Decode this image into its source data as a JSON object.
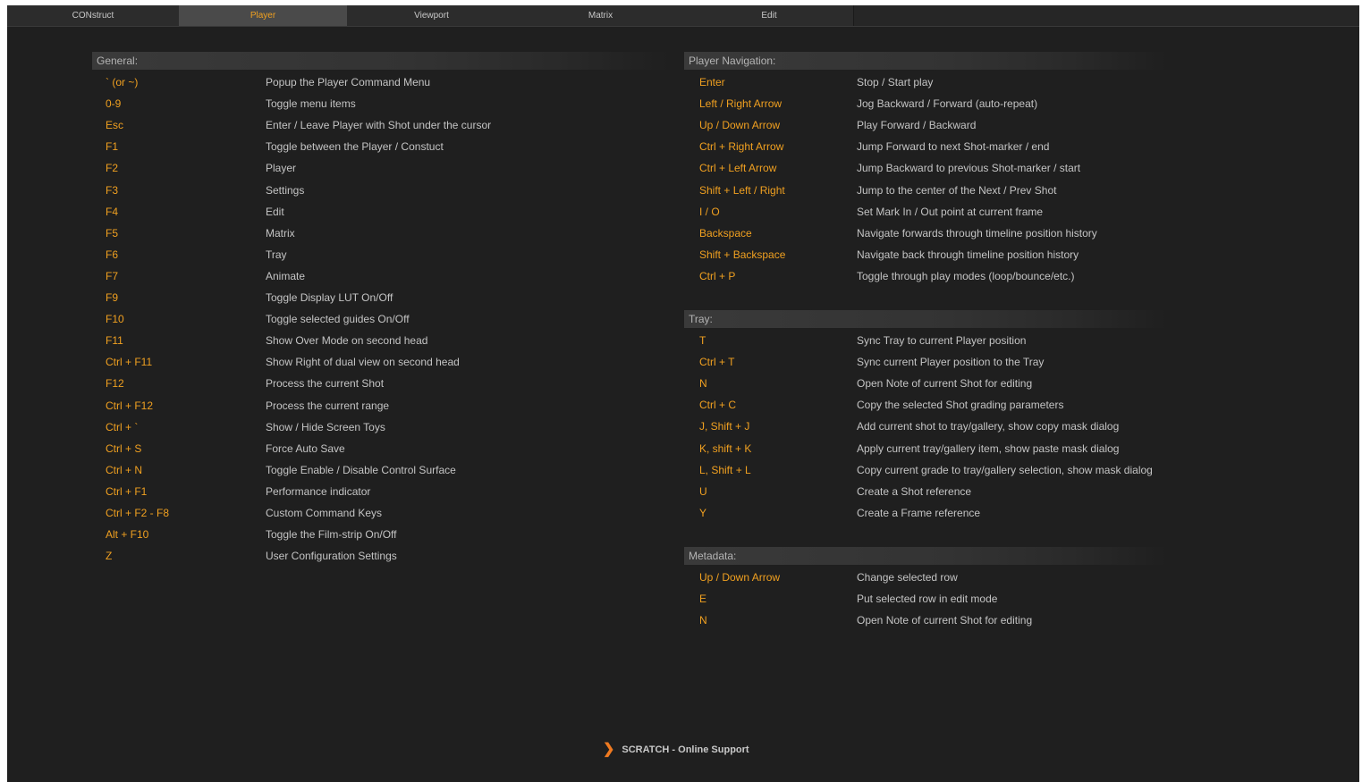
{
  "tabs": [
    {
      "label": "CONstruct",
      "active": false
    },
    {
      "label": "Player",
      "active": true
    },
    {
      "label": "Viewport",
      "active": false
    },
    {
      "label": "Matrix",
      "active": false
    },
    {
      "label": "Edit",
      "active": false
    }
  ],
  "sections": {
    "general": {
      "title": "General:",
      "rows": [
        {
          "key": "` (or ~)",
          "desc": "Popup the Player Command Menu"
        },
        {
          "key": "0-9",
          "desc": "Toggle menu items"
        },
        {
          "key": "Esc",
          "desc": "Enter / Leave Player with Shot under the cursor"
        },
        {
          "key": "F1",
          "desc": "Toggle between the Player / Constuct"
        },
        {
          "key": "F2",
          "desc": "Player"
        },
        {
          "key": "F3",
          "desc": "Settings"
        },
        {
          "key": "F4",
          "desc": "Edit"
        },
        {
          "key": "F5",
          "desc": "Matrix"
        },
        {
          "key": "F6",
          "desc": "Tray"
        },
        {
          "key": "F7",
          "desc": "Animate"
        },
        {
          "key": "F9",
          "desc": "Toggle Display LUT On/Off"
        },
        {
          "key": "F10",
          "desc": "Toggle selected guides On/Off"
        },
        {
          "key": "F11",
          "desc": "Show Over Mode on second head"
        },
        {
          "key": "Ctrl + F11",
          "desc": "Show Right of dual view on second head"
        },
        {
          "key": "F12",
          "desc": "Process the current Shot"
        },
        {
          "key": "Ctrl + F12",
          "desc": "Process the current range"
        },
        {
          "key": "Ctrl + `",
          "desc": "Show / Hide Screen Toys"
        },
        {
          "key": "Ctrl + S",
          "desc": "Force Auto Save"
        },
        {
          "key": "Ctrl + N",
          "desc": "Toggle Enable / Disable Control Surface"
        },
        {
          "key": "Ctrl + F1",
          "desc": "Performance indicator"
        },
        {
          "key": "Ctrl + F2 - F8",
          "desc": "Custom Command Keys"
        },
        {
          "key": "Alt + F10",
          "desc": "Toggle the Film-strip On/Off"
        },
        {
          "key": "Z",
          "desc": "User Configuration Settings"
        }
      ]
    },
    "player_navigation": {
      "title": "Player Navigation:",
      "rows": [
        {
          "key": "Enter",
          "desc": "Stop / Start play"
        },
        {
          "key": "Left / Right Arrow",
          "desc": "Jog Backward / Forward (auto-repeat)"
        },
        {
          "key": "Up / Down Arrow",
          "desc": "Play Forward / Backward"
        },
        {
          "key": "Ctrl + Right Arrow",
          "desc": "Jump Forward to next Shot-marker / end"
        },
        {
          "key": "Ctrl + Left Arrow",
          "desc": "Jump Backward to previous Shot-marker / start"
        },
        {
          "key": "Shift + Left / Right",
          "desc": "Jump to the center of the Next / Prev Shot"
        },
        {
          "key": "I / O",
          "desc": "Set Mark In / Out point at current frame"
        },
        {
          "key": "Backspace",
          "desc": "Navigate forwards through timeline position history"
        },
        {
          "key": "Shift + Backspace",
          "desc": "Navigate back through timeline position history"
        },
        {
          "key": "Ctrl + P",
          "desc": "Toggle through play modes (loop/bounce/etc.)"
        }
      ]
    },
    "tray": {
      "title": "Tray:",
      "rows": [
        {
          "key": "T",
          "desc": "Sync Tray to current Player position"
        },
        {
          "key": "Ctrl + T",
          "desc": "Sync current Player position to the Tray"
        },
        {
          "key": "N",
          "desc": "Open Note of current Shot for editing"
        },
        {
          "key": "Ctrl + C",
          "desc": "Copy the selected Shot grading parameters"
        },
        {
          "key": "J, Shift + J",
          "desc": "Add current shot to tray/gallery, show copy mask dialog"
        },
        {
          "key": "K, shift + K",
          "desc": "Apply current tray/gallery item, show paste mask dialog"
        },
        {
          "key": "L, Shift + L",
          "desc": "Copy current grade to tray/gallery selection, show mask dialog"
        },
        {
          "key": "U",
          "desc": "Create a Shot reference"
        },
        {
          "key": "Y",
          "desc": "Create a Frame reference"
        }
      ]
    },
    "metadata": {
      "title": "Metadata:",
      "rows": [
        {
          "key": "Up / Down Arrow",
          "desc": "Change selected row"
        },
        {
          "key": "E",
          "desc": "Put selected row in edit mode"
        },
        {
          "key": "N",
          "desc": "Open Note of current Shot for editing"
        }
      ]
    }
  },
  "footer": {
    "support_label": "SCRATCH - Online Support",
    "chevron_icon": "chevron-right-icon"
  },
  "colors": {
    "background": "#1f1f1f",
    "key_accent": "#f0a020",
    "chevron": "#f07a20",
    "active_tab_text": "#f0a020"
  }
}
